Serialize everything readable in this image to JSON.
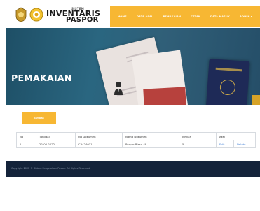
{
  "brand": {
    "line1": "INVENTARIS",
    "line2": "PASPOR",
    "sub": "SISTEM"
  },
  "nav": {
    "items": [
      "HOME",
      "DATA ASAL",
      "PEMAKAIAN",
      "CETAK",
      "DATA MASUK",
      "ADMIN ▾"
    ]
  },
  "hero": {
    "title": "PEMAKAIAN"
  },
  "toolbar": {
    "add_label": "Tambah"
  },
  "table": {
    "headers": [
      "No",
      "Tanggal",
      "No Dokumen",
      "Nama Dokumen",
      "Jumlah",
      "Aksi"
    ],
    "rows": [
      {
        "no": "1",
        "tanggal": "22-06-2022",
        "no_dokumen": "C3424011",
        "nama_dokumen": "Paspor Biasa 48",
        "jumlah": "5",
        "edit": "Edit",
        "delete": "Delete"
      }
    ]
  },
  "footer": {
    "text": "Copyright 2022 © Sistem Pengelolaan Paspor. All Rights Reserved"
  },
  "colors": {
    "accent": "#f7b733",
    "hero": "#2a6680",
    "footer": "#14233a",
    "link": "#3a7bd5"
  }
}
